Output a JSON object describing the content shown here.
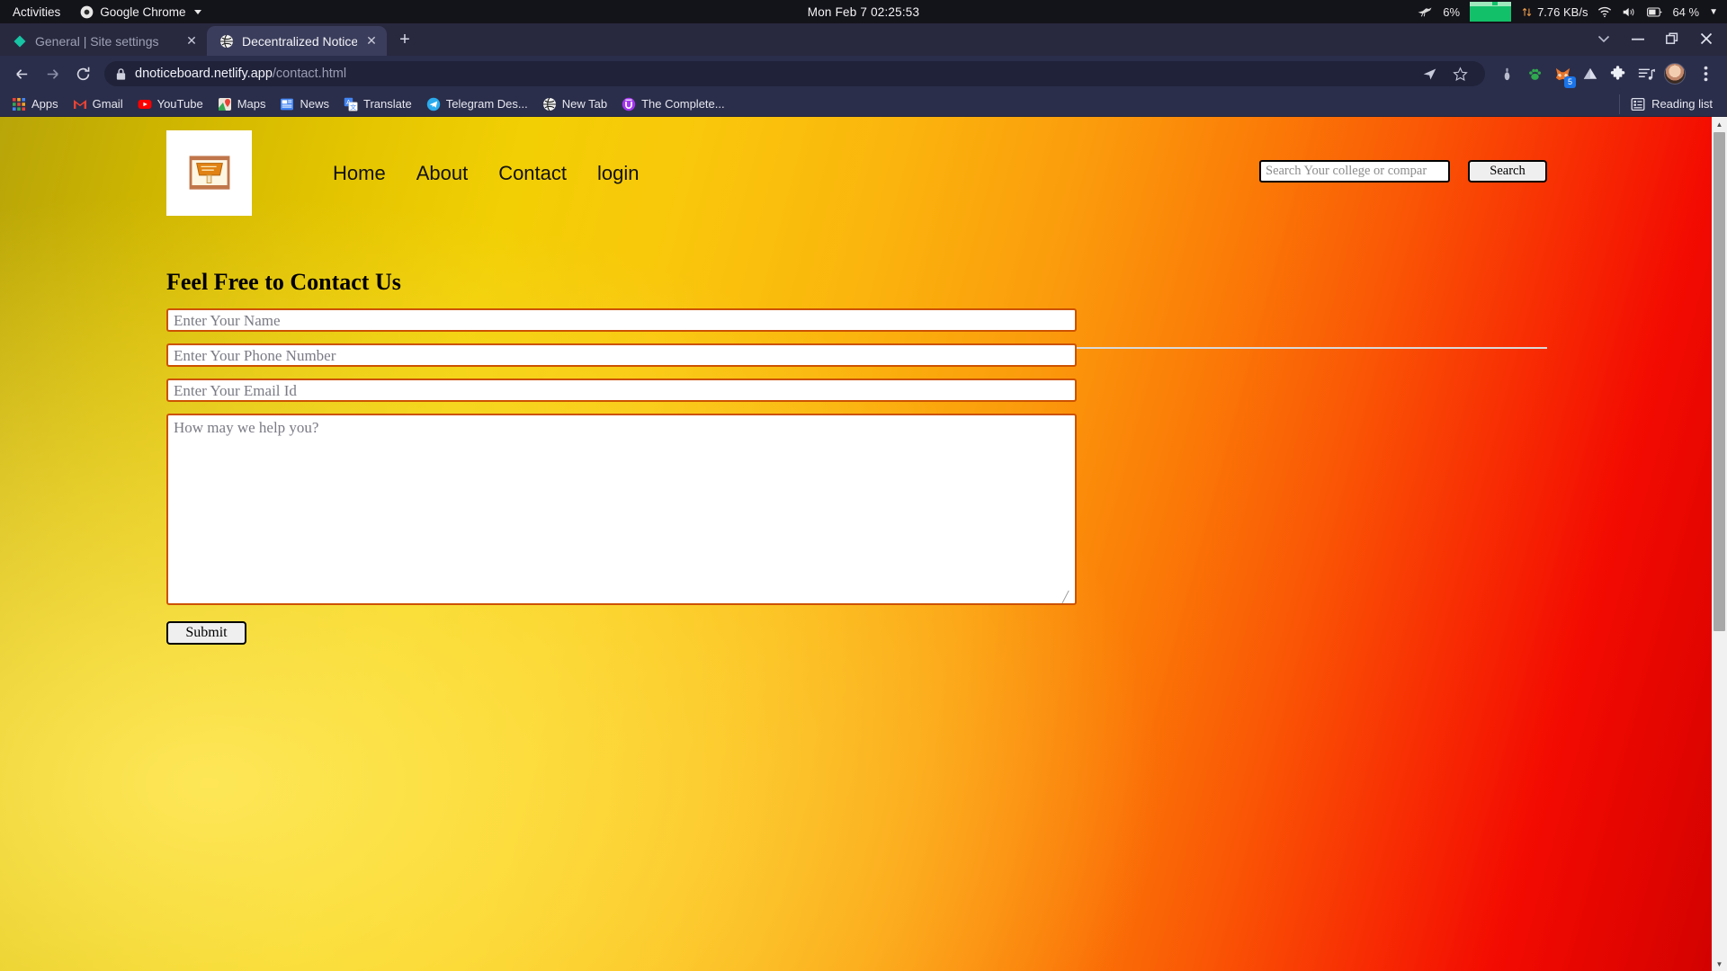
{
  "desktop": {
    "activities_label": "Activities",
    "app_menu_label": "Google Chrome",
    "clock": "Mon Feb 7  02:25:53",
    "tray": {
      "cpu_icon": "mouse-icon",
      "cpu_percent": "6%",
      "net_icon": "network-graph-icon",
      "net_transfer_icon": "up-down-arrows-icon",
      "net_speed": "7.76 KB/s",
      "wifi_icon": "wifi-icon",
      "volume_icon": "volume-icon",
      "battery_icon": "battery-icon",
      "battery_percent": "64 %",
      "menu_icon": "chevron-down-icon"
    }
  },
  "browser": {
    "tabs": [
      {
        "title": "General | Site settings",
        "favicon": "diamond-icon",
        "active": false,
        "close_label": "✕"
      },
      {
        "title": "Decentralized Notice Boa",
        "favicon": "globe-icon",
        "active": true,
        "close_label": "✕"
      }
    ],
    "new_tab_label": "+",
    "window_controls": {
      "tab_search_label": "⌄",
      "minimize_label": "—",
      "restore_label": "❐",
      "close_label": "✕"
    },
    "toolbar": {
      "back_icon": "back-arrow-icon",
      "forward_icon": "forward-arrow-icon",
      "reload_icon": "reload-icon",
      "lock_icon": "lock-icon",
      "url_host": "dnoticeboard.netlify.app",
      "url_path": "/contact.html",
      "share_icon": "share-icon",
      "bookmark_icon": "star-icon",
      "extensions": [
        {
          "name": "password-extension-icon",
          "badge": ""
        },
        {
          "name": "green-paw-extension-icon",
          "badge": ""
        },
        {
          "name": "metamask-fox-extension-icon",
          "badge": "5"
        },
        {
          "name": "triangle-extension-icon",
          "badge": ""
        },
        {
          "name": "puzzle-extensions-icon",
          "badge": ""
        },
        {
          "name": "media-playlist-icon",
          "badge": ""
        }
      ],
      "avatar_icon": "profile-avatar",
      "menu_icon": "three-dot-menu-icon"
    },
    "bookmarks": [
      {
        "label": "Apps",
        "icon": "apps-grid-icon"
      },
      {
        "label": "Gmail",
        "icon": "gmail-icon"
      },
      {
        "label": "YouTube",
        "icon": "youtube-icon"
      },
      {
        "label": "Maps",
        "icon": "maps-icon"
      },
      {
        "label": "News",
        "icon": "news-icon"
      },
      {
        "label": "Translate",
        "icon": "translate-icon"
      },
      {
        "label": "Telegram Des...",
        "icon": "telegram-icon"
      },
      {
        "label": "New Tab",
        "icon": "globe-icon"
      },
      {
        "label": "The Complete...",
        "icon": "udemy-icon"
      }
    ],
    "reading_list": {
      "label": "Reading list",
      "icon": "reading-list-icon"
    }
  },
  "site": {
    "logo_alt": "notice-board-logo",
    "nav": [
      {
        "label": "Home"
      },
      {
        "label": "About"
      },
      {
        "label": "Contact"
      },
      {
        "label": "login"
      }
    ],
    "search": {
      "placeholder": "Search Your college or compar",
      "value": "",
      "button_label": "Search"
    }
  },
  "form": {
    "title": "Feel Free to Contact Us",
    "fields": [
      {
        "name": "name",
        "placeholder": "Enter Your Name",
        "value": ""
      },
      {
        "name": "phone",
        "placeholder": "Enter Your Phone Number",
        "value": ""
      },
      {
        "name": "email",
        "placeholder": "Enter Your Email Id",
        "value": ""
      }
    ],
    "message": {
      "placeholder": "How may we help you?",
      "value": ""
    },
    "submit_label": "Submit"
  },
  "colors": {
    "input_border": "#cc5200",
    "page_gradient_start": "#b8a508",
    "page_gradient_end": "#cf0200",
    "chrome_frame": "#2b2e4a",
    "accent_blue": "#1a73e8"
  }
}
